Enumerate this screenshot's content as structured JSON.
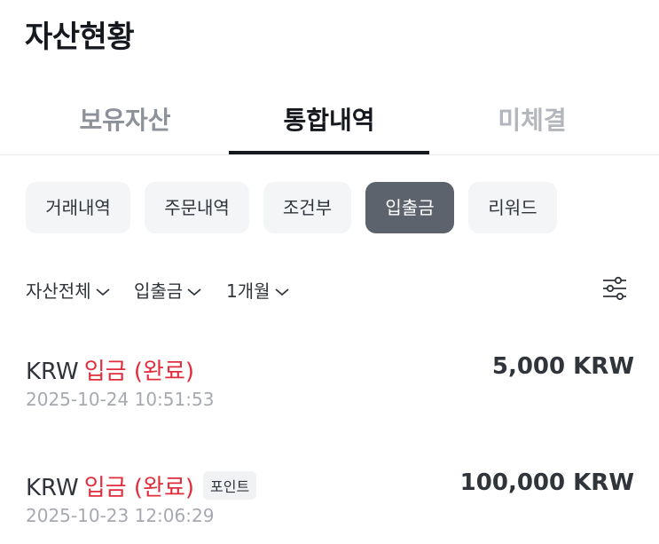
{
  "page": {
    "title": "자산현황"
  },
  "tabs": [
    {
      "label": "보유자산"
    },
    {
      "label": "통합내역"
    },
    {
      "label": "미체결"
    }
  ],
  "chips": [
    {
      "label": "거래내역"
    },
    {
      "label": "주문내역"
    },
    {
      "label": "조건부"
    },
    {
      "label": "입출금"
    },
    {
      "label": "리워드"
    }
  ],
  "filters": {
    "asset": "자산전체",
    "type": "입출금",
    "period": "1개월",
    "settings_icon": "sliders-icon"
  },
  "transactions": [
    {
      "currency": "KRW",
      "type": "입금 (완료)",
      "badge": "",
      "amount": "5,000 KRW",
      "time": "2025-10-24 10:51:53"
    },
    {
      "currency": "KRW",
      "type": "입금 (완료)",
      "badge": "포인트",
      "amount": "100,000 KRW",
      "time": "2025-10-23 12:06:29"
    }
  ],
  "colors": {
    "deposit": "#e02d3c",
    "active_chip": "#5d636c"
  }
}
